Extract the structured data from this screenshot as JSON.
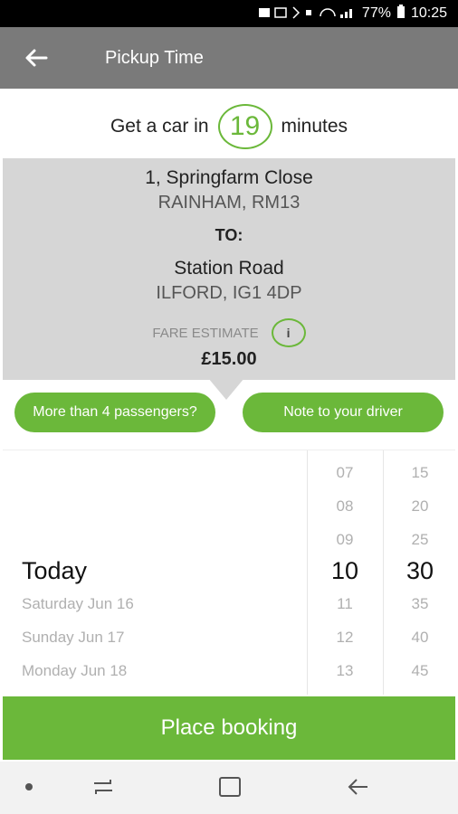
{
  "status": {
    "battery": "77%",
    "time": "10:25"
  },
  "toolbar": {
    "title": "Pickup Time"
  },
  "eta": {
    "prefix": "Get a car in",
    "minutes": "19",
    "suffix": "minutes"
  },
  "route": {
    "from_line1": "1, Springfarm Close",
    "from_line2": "RAINHAM, RM13",
    "to_label": "TO:",
    "to_line1": "Station Road",
    "to_line2": "ILFORD, IG1 4DP",
    "fare_label": "FARE ESTIMATE",
    "fare_value": "£15.00",
    "info_glyph": "i"
  },
  "buttons": {
    "passengers": "More than 4 passengers?",
    "note": "Note to your driver"
  },
  "picker": {
    "dates": [
      "Today",
      "Saturday Jun 16",
      "Sunday Jun 17",
      "Monday Jun 18"
    ],
    "hours": [
      "07",
      "08",
      "09",
      "10",
      "11",
      "12",
      "13"
    ],
    "minutes": [
      "15",
      "20",
      "25",
      "30",
      "35",
      "40",
      "45"
    ]
  },
  "cta": {
    "label": "Place booking"
  }
}
